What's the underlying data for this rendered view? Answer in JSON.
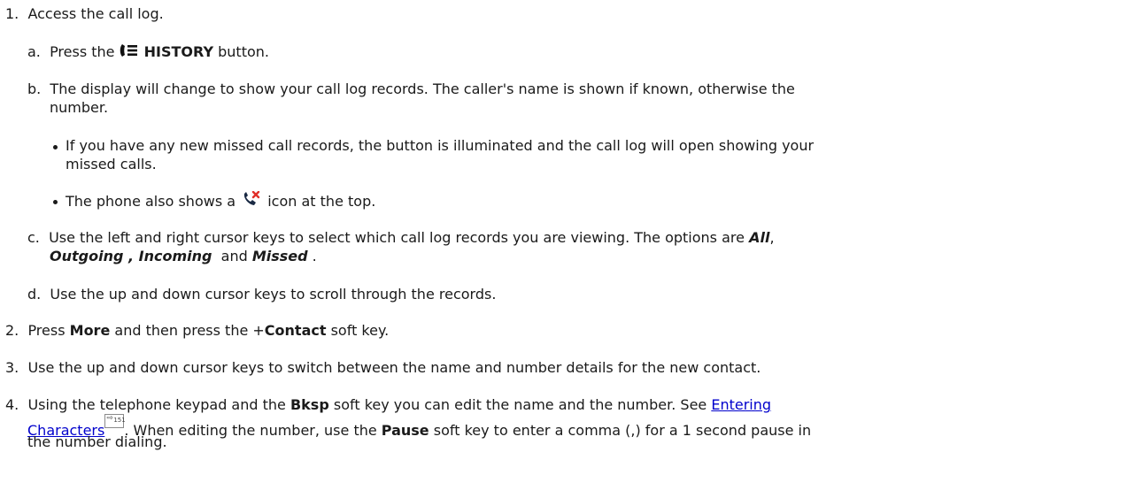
{
  "steps": {
    "s1": {
      "num": "1.",
      "text": "Access the call log."
    },
    "a": {
      "letter": "a.",
      "pre": "Press the",
      "history": "HISTORY",
      "post": "button."
    },
    "b": {
      "letter": "b.",
      "line1": "The display will change to show your call log records. The caller's name is shown if known, otherwise the",
      "line2": "number."
    },
    "bullet1": {
      "line1": "If you have any new missed call records, the button is illuminated and the call log will open showing your",
      "line2": "missed calls."
    },
    "bullet2": {
      "pre": "The phone also shows a",
      "post": "icon at the top."
    },
    "c": {
      "letter": "c.",
      "line1": "Use the left and right cursor keys to select which call log records you are viewing. The options are",
      "all": "All",
      "comma": ",",
      "outgoing": "Outgoing",
      "sep1": " , ",
      "incoming": "Incoming",
      "and": "  and ",
      "missed": "Missed",
      "end": " ."
    },
    "d": {
      "letter": "d.",
      "text": "Use the up and down cursor keys to scroll through the records."
    },
    "s2": {
      "num": "2.",
      "pre": "Press",
      "more": "More",
      "mid": "and then press the +",
      "contact": "Contact",
      "post": "soft key."
    },
    "s3": {
      "num": "3.",
      "text": "Use the up and down cursor keys to switch between the name and number details for the new contact."
    },
    "s4": {
      "num": "4.",
      "pre": "Using the telephone keypad and the",
      "bksp": "Bksp",
      "mid": "soft key you can edit the name and the number. See",
      "link1": "Entering",
      "link2": "Characters",
      "xref": "151",
      "line2a": ". When editing the number, use the",
      "pause": "Pause",
      "line2b": "soft key to enter a comma (,) for a 1 second pause in",
      "line3": "the number dialing."
    }
  },
  "icons": {
    "history": "call-history-icon",
    "missed": "missed-call-icon",
    "xref": "page-reference-icon"
  },
  "colors": {
    "text": "#1a1a1a",
    "link": "#0000cc",
    "missed_x": "#e0302a"
  }
}
